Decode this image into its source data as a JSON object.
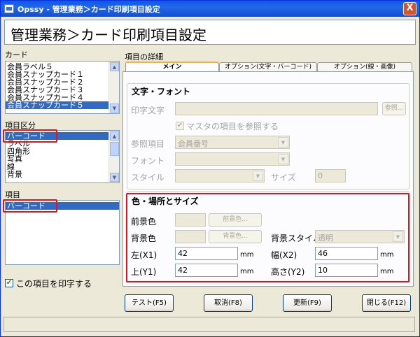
{
  "window": {
    "title": "Opssy - 管理業務＞カード印刷項目設定",
    "close_label": "X"
  },
  "header": {
    "title": "管理業務＞カード印刷項目設定"
  },
  "left": {
    "card_label": "カード",
    "card_items": [
      "会員ラベル５",
      "会員スナップカード１",
      "会員スナップカード２",
      "会員スナップカード３",
      "会員スナップカード４",
      "会員スナップカード５"
    ],
    "card_selected_index": 5,
    "category_label": "項目区分",
    "category_items": [
      "バーコード",
      "ラベル",
      "四角形",
      "写真",
      "線",
      "背景"
    ],
    "category_selected_index": 0,
    "item_label": "項目",
    "item_items": [
      "バーコード"
    ],
    "print_checkbox_label": "この項目を印字する",
    "print_checked": true
  },
  "details": {
    "label": "項目の詳細",
    "tabs": [
      "メイン",
      "オプション(文字・バーコード)",
      "オプション(線・画像)"
    ],
    "active_tab": 0,
    "text_font": {
      "title": "文字・フォント",
      "print_text_label": "印字文字",
      "ref_button": "参照...",
      "master_ref_label": "マスタの項目を参照する",
      "master_ref_checked": true,
      "ref_item_label": "参照項目",
      "ref_item_value": "会員番号",
      "font_label": "フォント",
      "style_label": "スタイル",
      "size_label": "サイズ",
      "size_value": "0"
    },
    "color_position": {
      "title": "色・場所とサイズ",
      "fg_label": "前景色",
      "fg_button": "前景色...",
      "bg_label": "背景色",
      "bg_button": "背景色...",
      "bg_style_label": "背景スタイル",
      "bg_style_value": "透明",
      "left_label": "左(X1)",
      "left_value": "42",
      "width_label": "幅(X2)",
      "width_value": "46",
      "top_label": "上(Y1)",
      "top_value": "42",
      "height_label": "高さ(Y2)",
      "height_value": "10",
      "unit": "mm"
    }
  },
  "buttons": {
    "test": "テスト(F5)",
    "cancel": "取消(F8)",
    "update": "更新(F9)",
    "close": "閉じる(F12)"
  },
  "colors": {
    "highlight_box": "#e0141e",
    "selection": "#316ac5",
    "titlebar": "#0a5ae8"
  }
}
